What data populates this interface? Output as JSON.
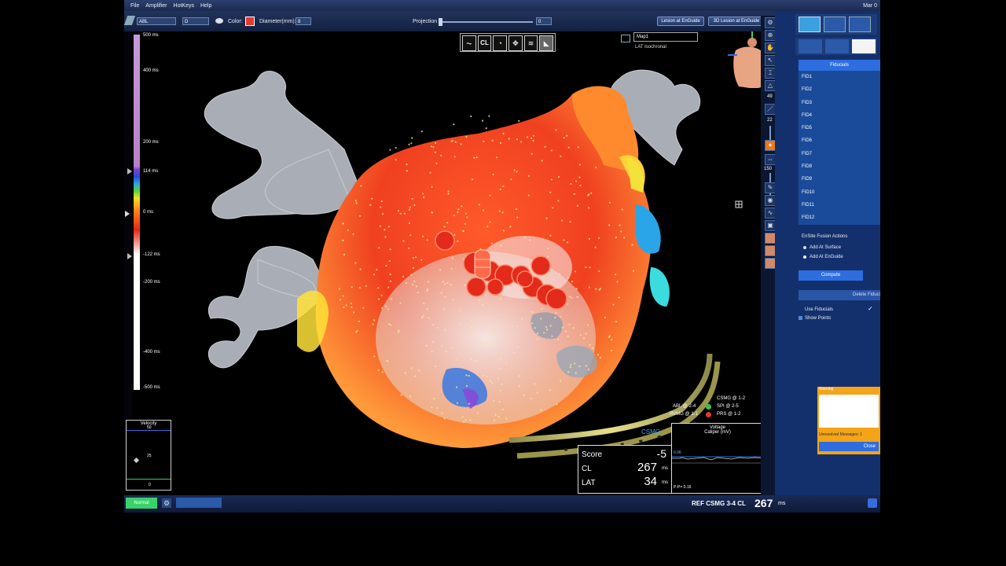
{
  "menu": {
    "items": [
      "File",
      "Amplifier",
      "HotKeys",
      "Help"
    ],
    "date": "Mar 0"
  },
  "toolbar": {
    "catheter": "ABL",
    "electrode": "D",
    "color_label": "Color:",
    "diameter_label": "Diameter(mm):",
    "diameter_value": "8",
    "projection_label": "Projection",
    "projection_value": "0",
    "lesion_btn": "Lesion at EnGuide",
    "lesion3d_btn": "3D Lesion at EnGuide"
  },
  "map": {
    "name": "Map1",
    "subtitle": "LAT Isochronal"
  },
  "view_toolbar": {
    "cl_label": "CL"
  },
  "color_scale": {
    "labels": [
      "500 ms",
      "400 ms",
      "200 ms",
      "114 ms",
      "0 ms",
      "-122 ms",
      "-200 ms",
      "-400 ms",
      "-500 ms"
    ],
    "values": [
      500,
      400,
      200,
      114,
      0,
      -122,
      -200,
      -400,
      -500
    ]
  },
  "velocity": {
    "title": "Velocity",
    "max": "50",
    "mid": "25",
    "min": "0"
  },
  "status": {
    "score_label": "Score",
    "score_value": "-5",
    "cl_label": "CL",
    "cl_value": "267",
    "cl_unit": "ms",
    "lat_label": "LAT",
    "lat_value": "34",
    "lat_unit": "ms"
  },
  "voltage": {
    "title": "Voltage",
    "subtitle": "Caliper (mV)",
    "pp": "P-P= 0.16",
    "top_val": "0.06"
  },
  "channels": {
    "items": [
      {
        "name": "CSMG @ 1-2",
        "color": "#e23a2a"
      },
      {
        "name": "ABL @ 2-4",
        "color": "#32c25a"
      },
      {
        "name": "SPI @ 2-5",
        "color": "#e45a2a"
      },
      {
        "name": "RVMG @ 1-1",
        "color": "#e23a2a"
      },
      {
        "name": "PRS @ 1-2",
        "color": "#32c25a"
      }
    ]
  },
  "catheter_label": "CSMG",
  "ref": {
    "label": "REF CSMG 3-4 CL",
    "value": "267",
    "unit": "ms"
  },
  "bottom_bar": {
    "button": "Normal"
  },
  "side_slider": {
    "top": "49",
    "mid": "22",
    "val": "150"
  },
  "right_panel": {
    "fiducials_title": "Fiducials",
    "fiducials": [
      "FID1",
      "FID2",
      "FID3",
      "FID4",
      "FID5",
      "FID6",
      "FID7",
      "FID8",
      "FID9",
      "FID10",
      "FID11",
      "FID12"
    ],
    "fusion_title": "EnSite Fusion Actions",
    "add_surface": "Add At Surface",
    "add_enguide": "Add At EnGuide",
    "compute_btn": "Compute",
    "delete_btn": "Delete Fiduci",
    "use_fiducials": "Use Fiducials",
    "show_points": "Show Points"
  },
  "popup": {
    "title": "Warning",
    "messages": "Unresolved Messages: 1",
    "close": "Close"
  },
  "colors": {
    "panel": "#14306c",
    "accent": "#2d6de0",
    "warning": "#f4a416"
  }
}
